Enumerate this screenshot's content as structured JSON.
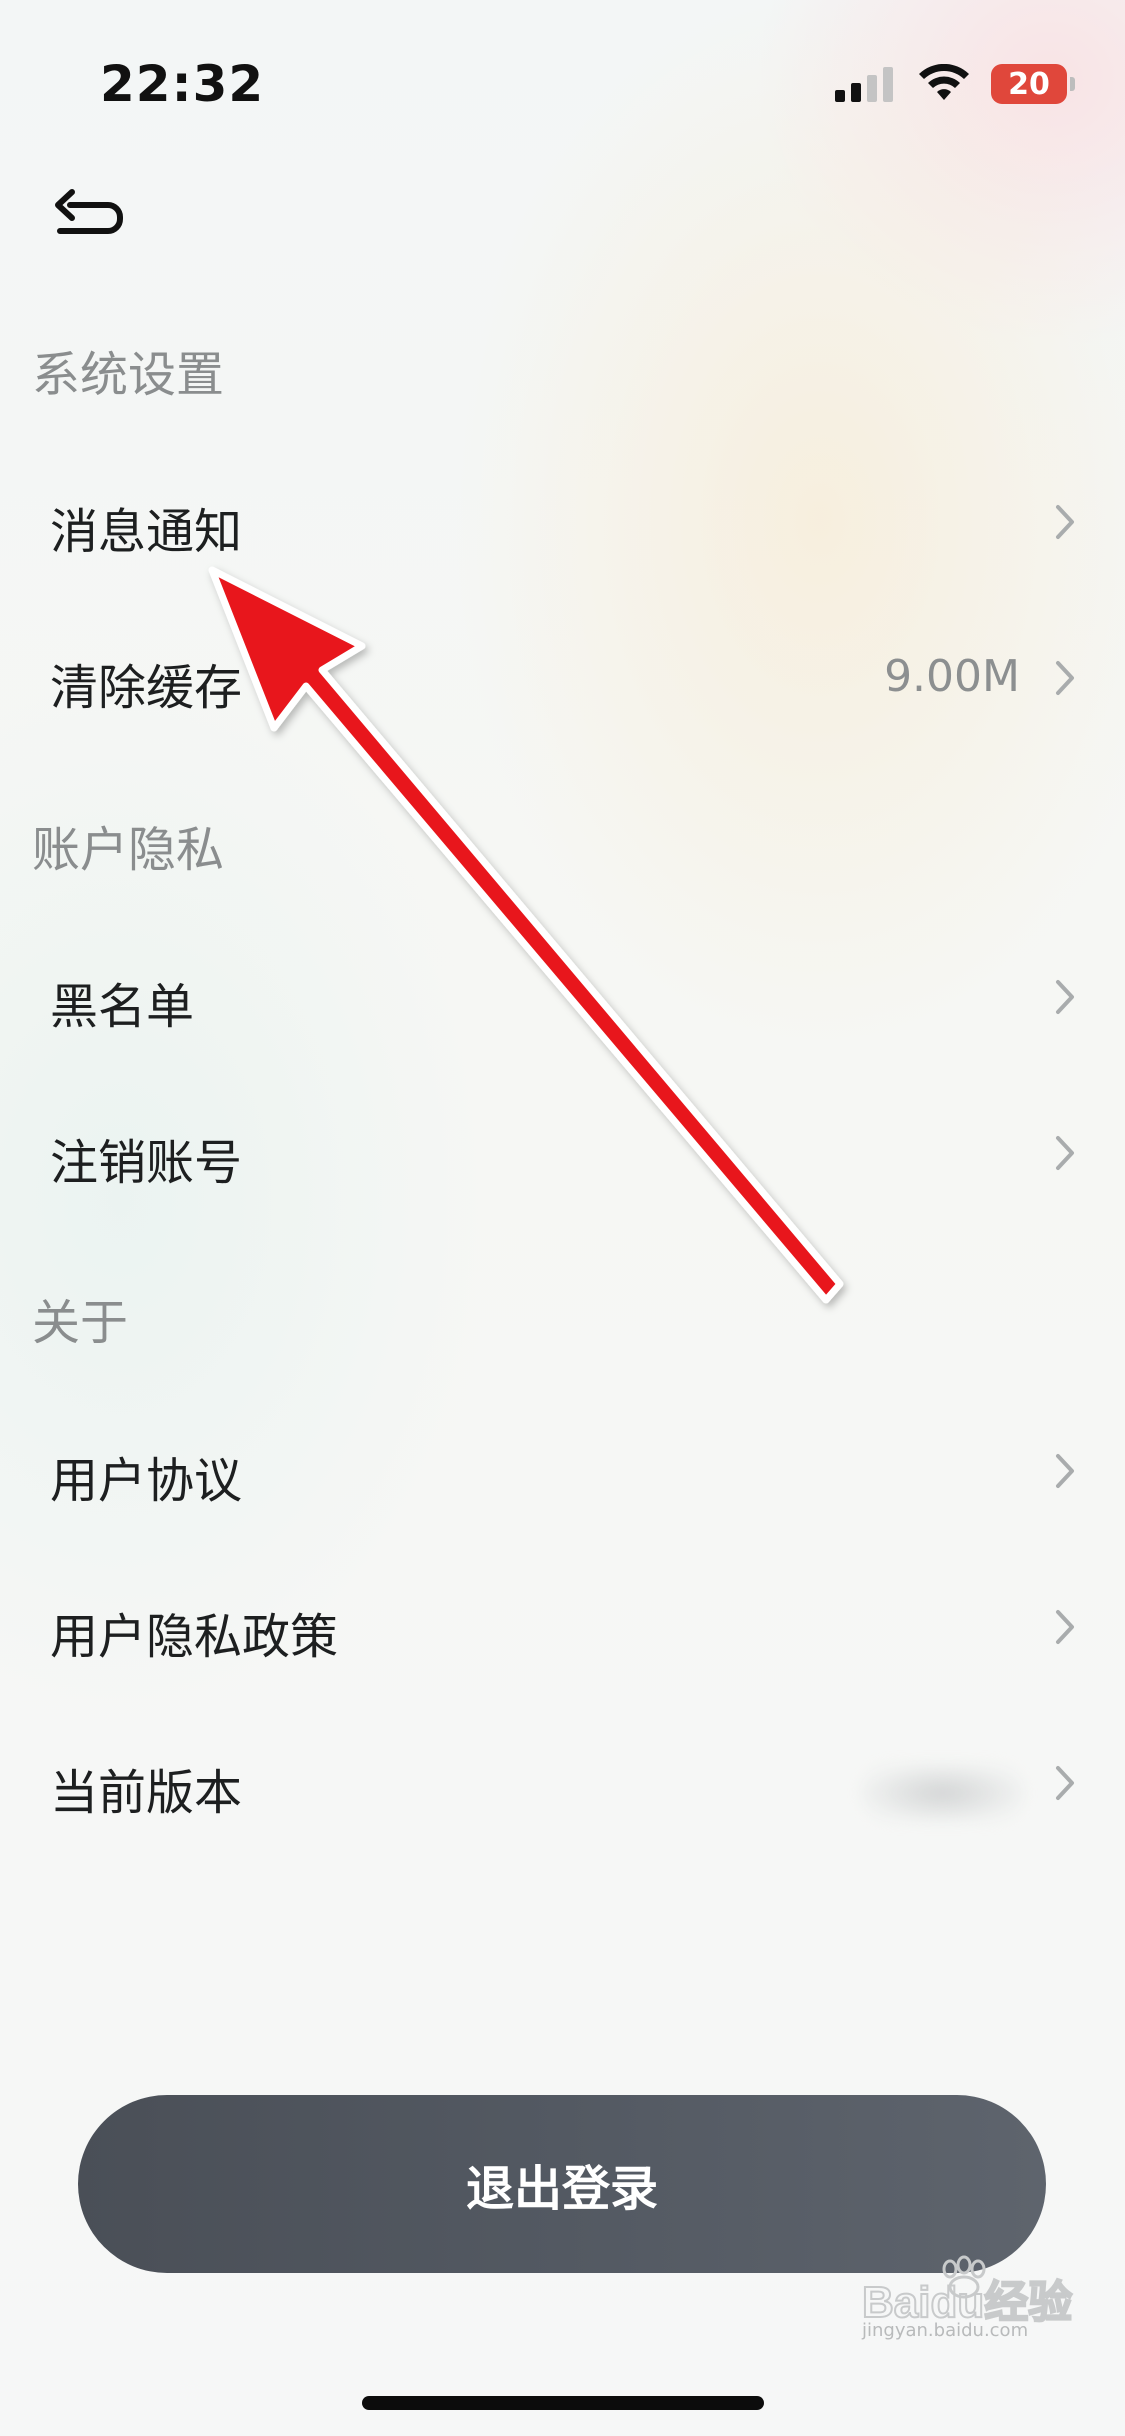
{
  "status_bar": {
    "time": "22:32",
    "battery": "20",
    "battery_color": "#e0473b",
    "signal_icon": "cellular-signal-icon",
    "wifi_icon": "wifi-icon"
  },
  "nav": {
    "back_icon": "back-arrow-icon"
  },
  "sections": [
    {
      "title": "系统设置",
      "items": [
        {
          "label": "消息通知",
          "value": ""
        },
        {
          "label": "清除缓存",
          "value": "9.00M"
        }
      ]
    },
    {
      "title": "账户隐私",
      "items": [
        {
          "label": "黑名单",
          "value": ""
        },
        {
          "label": "注销账号",
          "value": ""
        }
      ]
    },
    {
      "title": "关于",
      "items": [
        {
          "label": "用户协议",
          "value": ""
        },
        {
          "label": "用户隐私政策",
          "value": ""
        },
        {
          "label": "当前版本",
          "value": ""
        }
      ]
    }
  ],
  "logout_button": {
    "label": "退出登录",
    "color": "#535962"
  },
  "annotation": {
    "arrow_color": "#e8141b"
  },
  "watermark": {
    "brand": "Baidu经验",
    "url": "jingyan.baidu.com"
  }
}
